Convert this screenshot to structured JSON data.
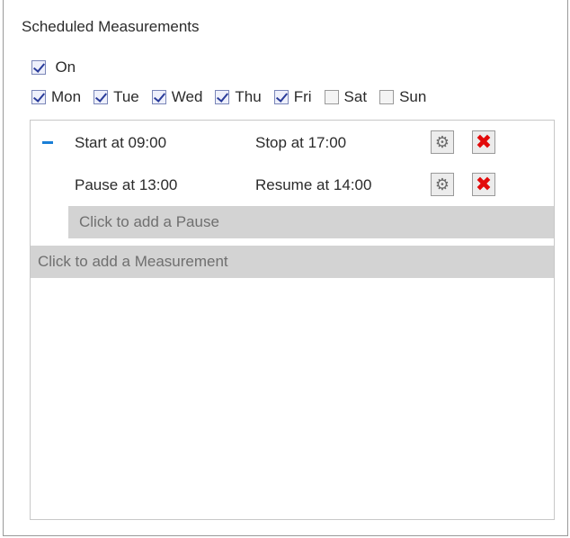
{
  "title": "Scheduled Measurements",
  "on": {
    "label": "On",
    "checked": true
  },
  "days": [
    {
      "label": "Mon",
      "checked": true
    },
    {
      "label": "Tue",
      "checked": true
    },
    {
      "label": "Wed",
      "checked": true
    },
    {
      "label": "Thu",
      "checked": true
    },
    {
      "label": "Fri",
      "checked": true
    },
    {
      "label": "Sat",
      "checked": false
    },
    {
      "label": "Sun",
      "checked": false
    }
  ],
  "measurement": {
    "start": "Start at 09:00",
    "stop": "Stop at 17:00",
    "pause": "Pause at 13:00",
    "resume": "Resume at 14:00",
    "add_pause": "Click to add a Pause"
  },
  "add_measurement": "Click to add a Measurement",
  "icons": {
    "settings": "gear-icon",
    "delete": "close-icon",
    "collapse": "minus-icon"
  },
  "colors": {
    "check": "#2a3c9a",
    "delete": "#e20a0a",
    "collapse": "#1a7fd6",
    "add_bg": "#d3d3d3"
  }
}
